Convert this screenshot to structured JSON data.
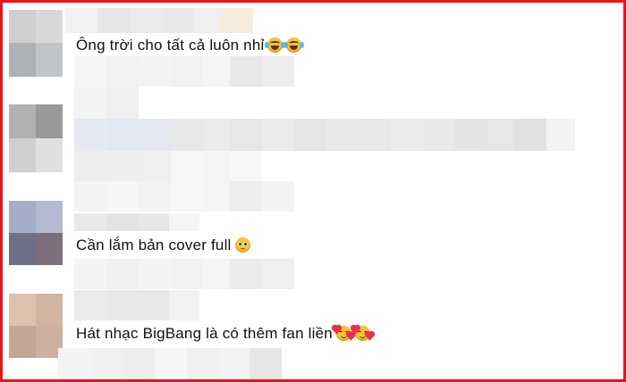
{
  "comments": [
    {
      "text": "Ông trời cho tất cả luôn nhỉ",
      "emojis": [
        "face-with-tears-of-joy-icon",
        "face-with-tears-of-joy-icon"
      ]
    },
    {
      "text": "Cần lắm bản cover full",
      "emojis": [
        "pleading-face-icon"
      ]
    },
    {
      "text": "Hát nhạc BigBang là có thêm fan liền",
      "emojis": [
        "smiling-face-with-hearts-icon",
        "smiling-face-with-hearts-icon"
      ]
    }
  ],
  "colors": {
    "border": "#e8141b",
    "text": "#111111",
    "blur_light": "#f4f4f4",
    "blur_mid": "#ececec",
    "blur_dark": "#e2e2e2",
    "emoji_yellow": "#f6c12f",
    "heart_red": "#e5334b"
  }
}
